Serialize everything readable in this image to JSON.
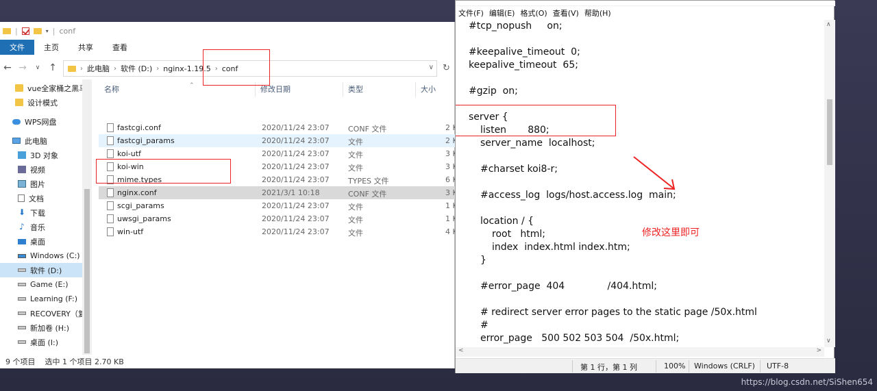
{
  "explorer": {
    "title_path": "conf",
    "ribbon_tabs": [
      "文件",
      "主页",
      "共享",
      "查看"
    ],
    "breadcrumb": [
      "此电脑",
      "软件 (D:)",
      "nginx-1.19.5",
      "conf"
    ],
    "sidebar": [
      {
        "label": "vue全家桶之黑马",
        "icon": "folder-icon"
      },
      {
        "label": "设计模式",
        "icon": "folder-icon"
      },
      {
        "label": "WPS网盘",
        "icon": "cloud-icon"
      },
      {
        "label": "此电脑",
        "icon": "computer-icon"
      },
      {
        "label": "3D 对象",
        "icon": "cube-icon"
      },
      {
        "label": "视频",
        "icon": "video-icon"
      },
      {
        "label": "图片",
        "icon": "picture-icon"
      },
      {
        "label": "文档",
        "icon": "document-icon"
      },
      {
        "label": "下载",
        "icon": "download-icon"
      },
      {
        "label": "音乐",
        "icon": "music-icon"
      },
      {
        "label": "桌面",
        "icon": "desktop-icon"
      },
      {
        "label": "Windows (C:)",
        "icon": "windows-drive-icon"
      },
      {
        "label": "软件 (D:)",
        "icon": "drive-icon"
      },
      {
        "label": "Game (E:)",
        "icon": "drive-icon"
      },
      {
        "label": "Learning (F:)",
        "icon": "drive-icon"
      },
      {
        "label": "RECOVERY（复",
        "icon": "drive-icon"
      },
      {
        "label": "新加卷 (H:)",
        "icon": "drive-icon"
      },
      {
        "label": "桌面 (I:)",
        "icon": "drive-icon"
      }
    ],
    "columns": {
      "name": "名称",
      "date": "修改日期",
      "type": "类型",
      "size": "大小"
    },
    "files": [
      {
        "name": "fastcgi.conf",
        "date": "2020/11/24 23:07",
        "type": "CONF 文件",
        "size": "2 K"
      },
      {
        "name": "fastcgi_params",
        "date": "2020/11/24 23:07",
        "type": "文件",
        "size": "2 K"
      },
      {
        "name": "koi-utf",
        "date": "2020/11/24 23:07",
        "type": "文件",
        "size": "3 K"
      },
      {
        "name": "koi-win",
        "date": "2020/11/24 23:07",
        "type": "文件",
        "size": "3 K"
      },
      {
        "name": "mime.types",
        "date": "2020/11/24 23:07",
        "type": "TYPES 文件",
        "size": "6 K"
      },
      {
        "name": "nginx.conf",
        "date": "2021/3/1 10:18",
        "type": "CONF 文件",
        "size": "3 K"
      },
      {
        "name": "scgi_params",
        "date": "2020/11/24 23:07",
        "type": "文件",
        "size": "1 K"
      },
      {
        "name": "uwsgi_params",
        "date": "2020/11/24 23:07",
        "type": "文件",
        "size": "1 K"
      },
      {
        "name": "win-utf",
        "date": "2020/11/24 23:07",
        "type": "文件",
        "size": "4 K"
      }
    ],
    "status": {
      "count": "9 个项目",
      "selected": "选中 1 个项目  2.70 KB"
    }
  },
  "notepad": {
    "menu": [
      "文件(F)",
      "编辑(E)",
      "格式(O)",
      "查看(V)",
      "帮助(H)"
    ],
    "lines": [
      {
        "text": "#tcp_nopush     on;",
        "indent": 0
      },
      {
        "text": "",
        "indent": 0
      },
      {
        "text": "#keepalive_timeout  0;",
        "indent": 0
      },
      {
        "text": "keepalive_timeout  65;",
        "indent": 0
      },
      {
        "text": "",
        "indent": 0
      },
      {
        "text": "#gzip  on;",
        "indent": 0
      },
      {
        "text": "",
        "indent": 0
      },
      {
        "text": "server {",
        "indent": 0
      },
      {
        "text": "listen       880;",
        "indent": 1
      },
      {
        "text": "server_name  localhost;",
        "indent": 1
      },
      {
        "text": "",
        "indent": 0
      },
      {
        "text": "#charset koi8-r;",
        "indent": 1
      },
      {
        "text": "",
        "indent": 0
      },
      {
        "text": "#access_log  logs/host.access.log  main;",
        "indent": 1
      },
      {
        "text": "",
        "indent": 0
      },
      {
        "text": "location / {",
        "indent": 1
      },
      {
        "text": "root   html;",
        "indent": 2
      },
      {
        "text": "index  index.html index.htm;",
        "indent": 2
      },
      {
        "text": "}",
        "indent": 1
      },
      {
        "text": "",
        "indent": 0
      },
      {
        "text": "#error_page  404              /404.html;",
        "indent": 1
      },
      {
        "text": "",
        "indent": 0
      },
      {
        "text": "# redirect server error pages to the static page /50x.html",
        "indent": 1
      },
      {
        "text": "#",
        "indent": 1
      },
      {
        "text": "error_page   500 502 503 504  /50x.html;",
        "indent": 1
      }
    ],
    "annotation": "修改这里即可",
    "status": {
      "position": "第 1 行，第 1 列",
      "zoom": "100%",
      "line_ending": "Windows (CRLF)",
      "encoding": "UTF-8"
    }
  },
  "watermark": "https://blog.csdn.net/SiShen654",
  "colors": {
    "accent": "#1f6fb5",
    "annotation_red": "#e22222",
    "selection": "#cce4f7"
  }
}
